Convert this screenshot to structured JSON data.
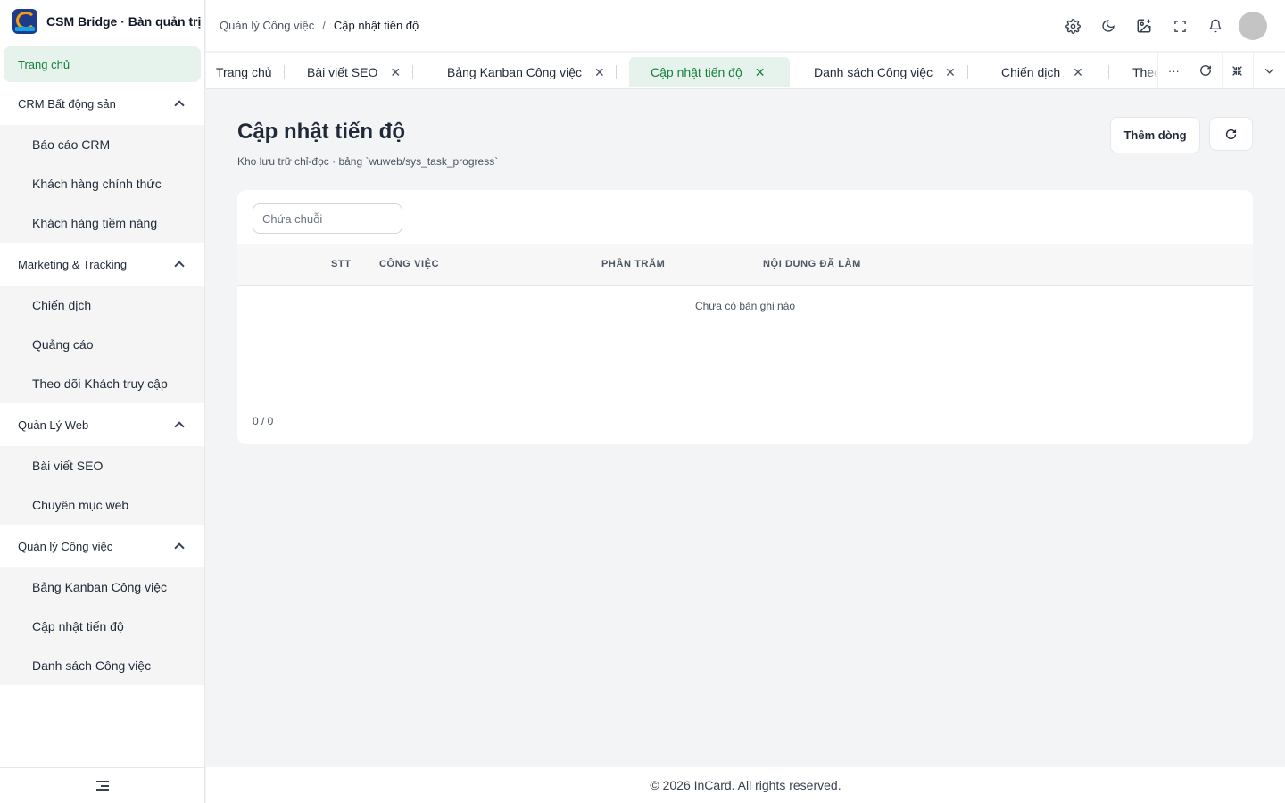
{
  "app": {
    "title": "CSM Bridge · Bàn quản trị"
  },
  "sidebar": {
    "home": "Trang chủ",
    "groups": [
      {
        "label": "CRM Bất động sản",
        "items": [
          "Báo cáo CRM",
          "Khách hàng chính thức",
          "Khách hàng tiềm năng"
        ]
      },
      {
        "label": "Marketing & Tracking",
        "items": [
          "Chiến dịch",
          "Quảng cáo",
          "Theo dõi Khách truy cập"
        ]
      },
      {
        "label": "Quản Lý Web",
        "items": [
          "Bài viết SEO",
          "Chuyên mục web"
        ]
      },
      {
        "label": "Quản lý Công việc",
        "items": [
          "Bảng Kanban Công việc",
          "Cập nhật tiến độ",
          "Danh sách Công việc"
        ]
      }
    ]
  },
  "header": {
    "breadcrumb_parent": "Quản lý Công việc",
    "breadcrumb_sep": "/",
    "breadcrumb_current": "Cập nhật tiến độ"
  },
  "tabs": {
    "items": [
      "Trang chủ",
      "Bài viết SEO",
      "Bảng Kanban Công việc",
      "Cập nhật tiến độ",
      "Danh sách Công việc",
      "Chiến dịch",
      "Theo"
    ],
    "close_glyph": "✕",
    "more_glyph": "···",
    "active_index": 3
  },
  "page": {
    "title": "Cập nhật tiến độ",
    "subtitle": "Kho lưu trữ chỉ-đọc · bảng `wuweb/sys_task_progress`",
    "add_button": "Thêm dòng"
  },
  "table": {
    "search_placeholder": "Chứa chuỗi",
    "columns": [
      "STT",
      "CÔNG VIỆC",
      "PHẦN TRĂM",
      "NỘI DUNG ĐÃ LÀM"
    ],
    "empty_text": "Chưa có bản ghi nào",
    "count": "0 / 0"
  },
  "footer": {
    "text": "© 2026 InCard. All rights reserved."
  },
  "colors": {
    "accent": "#15803d",
    "accent_bg": "#e6f2ec"
  }
}
